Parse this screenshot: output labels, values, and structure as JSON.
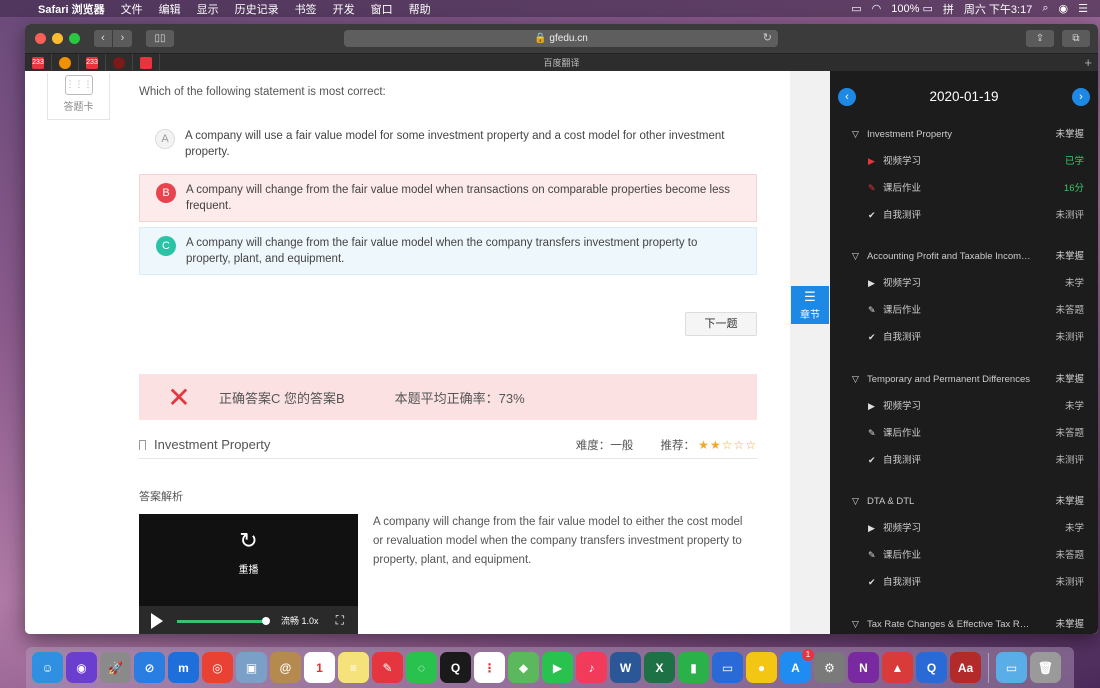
{
  "menubar": {
    "app": "Safari 浏览器",
    "menus": [
      "文件",
      "编辑",
      "显示",
      "历史记录",
      "书签",
      "开发",
      "窗口",
      "帮助"
    ],
    "battery": "100%",
    "input_method": "拼",
    "clock": "周六 下午3:17"
  },
  "browser": {
    "url": "gfedu.cn",
    "favbar_title": "百度翻译",
    "favorites": [
      {
        "name": "fav-acfun",
        "label": "233",
        "color": "#e5363f"
      },
      {
        "name": "fav-weibo",
        "label": "",
        "color": "#f29100"
      },
      {
        "name": "fav-233",
        "label": "233",
        "color": "#e5363f"
      },
      {
        "name": "fav-dark",
        "label": "",
        "color": "#7a1a1a"
      },
      {
        "name": "fav-red",
        "label": "",
        "color": "#e5363f"
      }
    ]
  },
  "sidebar_card": {
    "label": "答题卡"
  },
  "question": {
    "text": "Which of the following statement is most correct:",
    "options": [
      {
        "letter": "A",
        "text": "A company will use a fair value model for some investment property and a cost model for other investment property."
      },
      {
        "letter": "B",
        "text": "A company will change from the fair value model when transactions on comparable properties become less frequent."
      },
      {
        "letter": "C",
        "text": "A company will change from the fair value model when the company transfers investment property to property, plant, and equipment."
      }
    ],
    "next_label": "下一题"
  },
  "result": {
    "answer_text": "正确答案C 您的答案B",
    "accuracy_text": "本题平均正确率：73%"
  },
  "knowledge_point": {
    "title": "Investment Property",
    "difficulty_label": "难度：一般",
    "rating_label": "推荐：",
    "rating": 2,
    "rating_max": 5
  },
  "analysis": {
    "title": "答案解析",
    "text": "A company will change from the fair value model to either the cost model or revaluation model when the company transfers investment property to property, plant, and equipment.",
    "video": {
      "replay_label": "重播",
      "quality_label": "流畅 1.0x",
      "progress": 0.95
    }
  },
  "chapter_button": {
    "label": "章节"
  },
  "panel": {
    "date": "2020-01-19",
    "sections": [
      {
        "title": "Investment Property",
        "status": "未掌握",
        "items": [
          {
            "icon": "play",
            "label": "视频学习",
            "status": "已学",
            "status_color": "green",
            "icon_color": "red"
          },
          {
            "icon": "pen",
            "label": "课后作业",
            "status": "16分",
            "status_color": "green",
            "icon_color": "red"
          },
          {
            "icon": "check",
            "label": "自我测评",
            "status": "未测评",
            "status_color": "gray",
            "icon_color": "white"
          }
        ]
      },
      {
        "title": "Accounting Profit and Taxable Incom…",
        "status": "未掌握",
        "items": [
          {
            "icon": "play",
            "label": "视频学习",
            "status": "未学",
            "status_color": "gray",
            "icon_color": "white"
          },
          {
            "icon": "pen",
            "label": "课后作业",
            "status": "未答题",
            "status_color": "gray",
            "icon_color": "white"
          },
          {
            "icon": "check",
            "label": "自我测评",
            "status": "未测评",
            "status_color": "gray",
            "icon_color": "white"
          }
        ]
      },
      {
        "title": "Temporary and Permanent Differences",
        "status": "未掌握",
        "items": [
          {
            "icon": "play",
            "label": "视频学习",
            "status": "未学",
            "status_color": "gray",
            "icon_color": "white"
          },
          {
            "icon": "pen",
            "label": "课后作业",
            "status": "未答题",
            "status_color": "gray",
            "icon_color": "white"
          },
          {
            "icon": "check",
            "label": "自我测评",
            "status": "未测评",
            "status_color": "gray",
            "icon_color": "white"
          }
        ]
      },
      {
        "title": "DTA & DTL",
        "status": "未掌握",
        "items": [
          {
            "icon": "play",
            "label": "视频学习",
            "status": "未学",
            "status_color": "gray",
            "icon_color": "white"
          },
          {
            "icon": "pen",
            "label": "课后作业",
            "status": "未答题",
            "status_color": "gray",
            "icon_color": "white"
          },
          {
            "icon": "check",
            "label": "自我测评",
            "status": "未测评",
            "status_color": "gray",
            "icon_color": "white"
          }
        ]
      },
      {
        "title": "Tax Rate Changes & Effective Tax R…",
        "status": "未掌握",
        "items": []
      }
    ]
  },
  "dock": {
    "apps": [
      {
        "name": "finder",
        "color": "#2f8fe0",
        "glyph": "☺"
      },
      {
        "name": "siri",
        "color": "#6a3fd0",
        "glyph": "◉"
      },
      {
        "name": "launchpad",
        "color": "#8a8a8a",
        "glyph": "🚀"
      },
      {
        "name": "safari",
        "color": "#2a7de1",
        "glyph": "⊘"
      },
      {
        "name": "meituan",
        "color": "#1e6fd9",
        "glyph": "m"
      },
      {
        "name": "chrome",
        "color": "#e94235",
        "glyph": "◎"
      },
      {
        "name": "preview",
        "color": "#7aa0c8",
        "glyph": "▣"
      },
      {
        "name": "contacts",
        "color": "#b58a4e",
        "glyph": "@"
      },
      {
        "name": "calendar",
        "color": "#ffffff",
        "glyph": "1"
      },
      {
        "name": "notes",
        "color": "#f6e27a",
        "glyph": "≡"
      },
      {
        "name": "xmind",
        "color": "#e5363f",
        "glyph": "✎"
      },
      {
        "name": "wechat",
        "color": "#2ac24e",
        "glyph": "◌"
      },
      {
        "name": "qq",
        "color": "#1a1a1a",
        "glyph": "Q"
      },
      {
        "name": "reminders",
        "color": "#ffffff",
        "glyph": "⋮"
      },
      {
        "name": "maps",
        "color": "#5cb85c",
        "glyph": "◆"
      },
      {
        "name": "facetime",
        "color": "#2ac24e",
        "glyph": "▶"
      },
      {
        "name": "music",
        "color": "#f23a5a",
        "glyph": "♪"
      },
      {
        "name": "word",
        "color": "#2b5797",
        "glyph": "W"
      },
      {
        "name": "excel",
        "color": "#1e7145",
        "glyph": "X"
      },
      {
        "name": "numbers",
        "color": "#2ab14a",
        "glyph": "▮"
      },
      {
        "name": "keynote",
        "color": "#2a6ad6",
        "glyph": "▭"
      },
      {
        "name": "mindnode",
        "color": "#f3c614",
        "glyph": "●"
      },
      {
        "name": "appstore",
        "color": "#1e8cf0",
        "glyph": "A"
      },
      {
        "name": "settings",
        "color": "#7a7a7a",
        "glyph": "⚙"
      },
      {
        "name": "onenote",
        "color": "#7a2aa0",
        "glyph": "N"
      },
      {
        "name": "flag-app",
        "color": "#d93a3a",
        "glyph": "▲"
      },
      {
        "name": "quicktime",
        "color": "#2a6ad6",
        "glyph": "Q"
      },
      {
        "name": "dictionary",
        "color": "#b22a2a",
        "glyph": "Aa"
      },
      {
        "name": "folder",
        "color": "#5aaee8",
        "glyph": "▭"
      },
      {
        "name": "trash",
        "color": "#9a9a9a",
        "glyph": "🗑"
      }
    ],
    "appstore_badge": "1"
  }
}
